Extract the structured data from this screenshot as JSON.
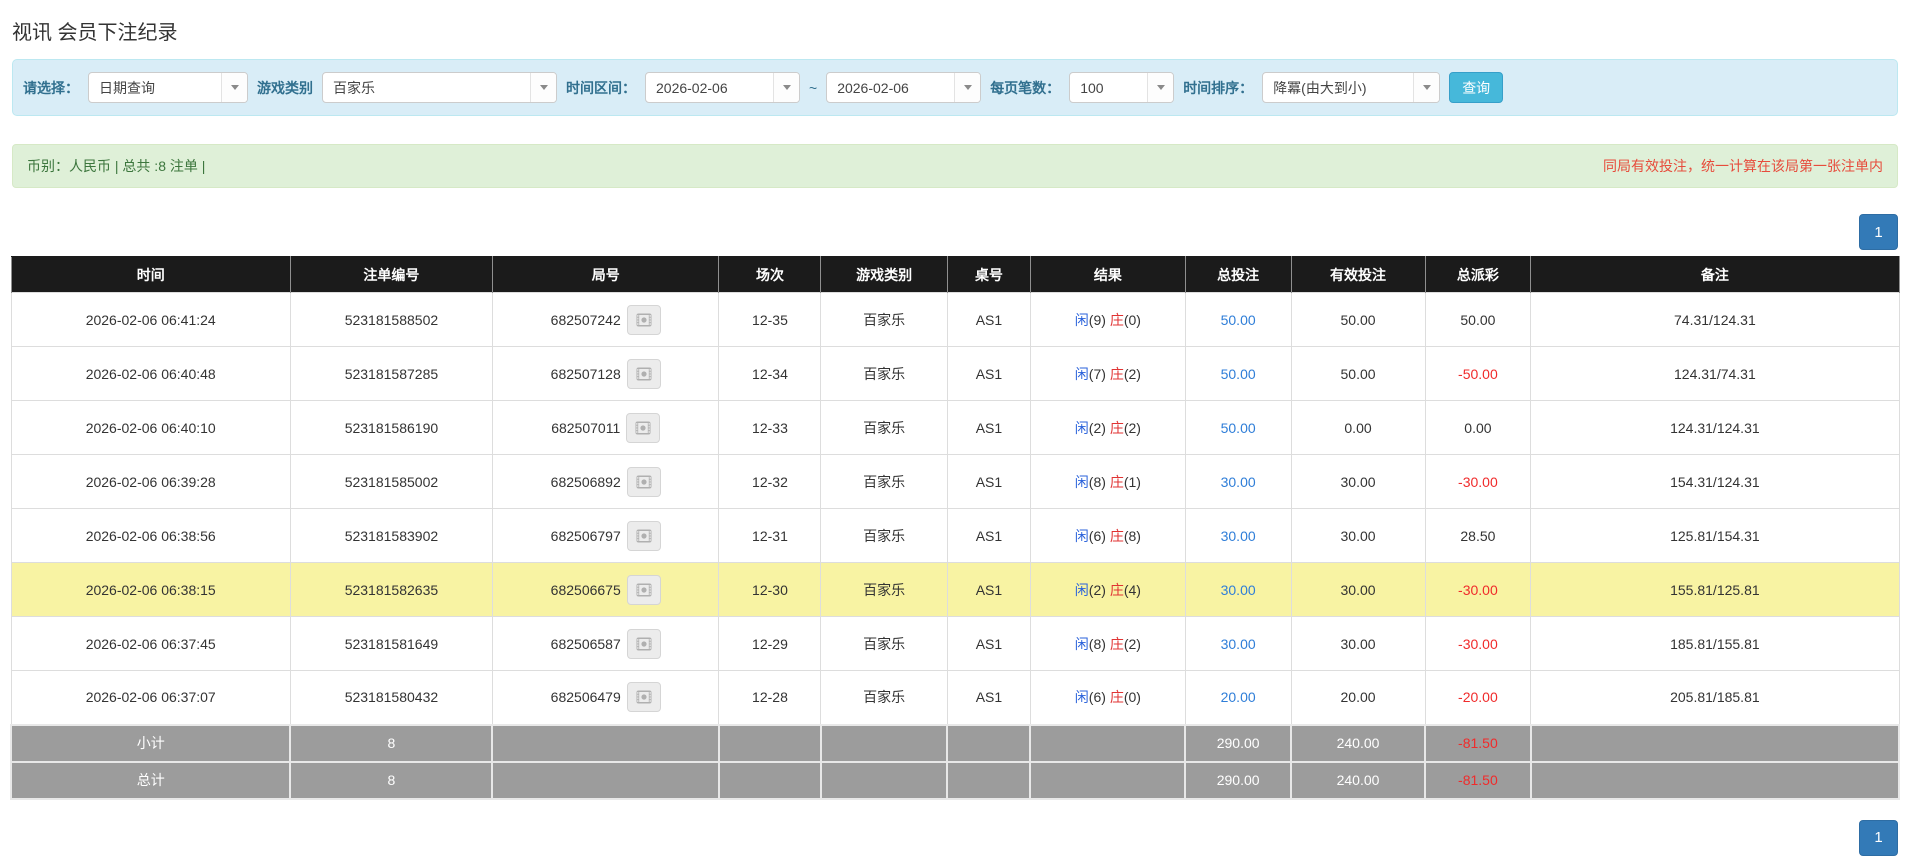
{
  "page": {
    "title": "视讯 会员下注纪录"
  },
  "filters": {
    "mode_label": "请选择：",
    "mode_value": "日期查询",
    "game_label": "游戏类别",
    "game_value": "百家乐",
    "range_label": "时间区间：",
    "range_start": "2026-02-06",
    "range_separator": "~",
    "range_end": "2026-02-06",
    "per_page_label": "每页笔数：",
    "per_page_value": "100",
    "sort_label": "时间排序：",
    "sort_value": "降冪(由大到小)",
    "search_button": "查询"
  },
  "summary": {
    "left": "币别：人民币 | 总共 :8 注单 |",
    "right": "同局有效投注，统一计算在该局第一张注单内"
  },
  "pagination": {
    "current_page": "1"
  },
  "icons": {
    "select_caret": "chevron-down-icon",
    "video_replay": "film-icon"
  },
  "colors": {
    "panel_bg": "#d9edf7",
    "summary_bg": "#dff0d8",
    "summary_text": "#3c763d",
    "warning_text": "#e74c3c",
    "header_bg": "#1b1b1b",
    "footer_bg": "#9c9c9c",
    "highlight_row": "#f8f3a3",
    "pagination_active": "#337ab7",
    "link_blue": "#2f7ed8",
    "player_blue": "#2a62db",
    "banker_red": "#e03333",
    "negative_red": "#f02b2b",
    "button_blue": "#46b8da"
  },
  "table": {
    "headers": [
      "时间",
      "注单编号",
      "局号",
      "场次",
      "游戏类别",
      "桌号",
      "结果",
      "总投注",
      "有效投注",
      "总派彩",
      "备注"
    ],
    "rows": [
      {
        "time": "2026-02-06 06:41:24",
        "bet_id": "523181588502",
        "round_id": "682507242",
        "session": "12-35",
        "game": "百家乐",
        "table_no": "AS1",
        "res_p_label": "闲",
        "res_p_num": "(9)",
        "res_b_label": "庄",
        "res_b_num": "(0)",
        "total_bet": "50.00",
        "valid_bet": "50.00",
        "payout": "50.00",
        "note": "74.31/124.31",
        "highlight": false
      },
      {
        "time": "2026-02-06 06:40:48",
        "bet_id": "523181587285",
        "round_id": "682507128",
        "session": "12-34",
        "game": "百家乐",
        "table_no": "AS1",
        "res_p_label": "闲",
        "res_p_num": "(7)",
        "res_b_label": "庄",
        "res_b_num": "(2)",
        "total_bet": "50.00",
        "valid_bet": "50.00",
        "payout": "-50.00",
        "note": "124.31/74.31",
        "highlight": false
      },
      {
        "time": "2026-02-06 06:40:10",
        "bet_id": "523181586190",
        "round_id": "682507011",
        "session": "12-33",
        "game": "百家乐",
        "table_no": "AS1",
        "res_p_label": "闲",
        "res_p_num": "(2)",
        "res_b_label": "庄",
        "res_b_num": "(2)",
        "total_bet": "50.00",
        "valid_bet": "0.00",
        "payout": "0.00",
        "note": "124.31/124.31",
        "highlight": false
      },
      {
        "time": "2026-02-06 06:39:28",
        "bet_id": "523181585002",
        "round_id": "682506892",
        "session": "12-32",
        "game": "百家乐",
        "table_no": "AS1",
        "res_p_label": "闲",
        "res_p_num": "(8)",
        "res_b_label": "庄",
        "res_b_num": "(1)",
        "total_bet": "30.00",
        "valid_bet": "30.00",
        "payout": "-30.00",
        "note": "154.31/124.31",
        "highlight": false
      },
      {
        "time": "2026-02-06 06:38:56",
        "bet_id": "523181583902",
        "round_id": "682506797",
        "session": "12-31",
        "game": "百家乐",
        "table_no": "AS1",
        "res_p_label": "闲",
        "res_p_num": "(6)",
        "res_b_label": "庄",
        "res_b_num": "(8)",
        "total_bet": "30.00",
        "valid_bet": "30.00",
        "payout": "28.50",
        "note": "125.81/154.31",
        "highlight": false
      },
      {
        "time": "2026-02-06 06:38:15",
        "bet_id": "523181582635",
        "round_id": "682506675",
        "session": "12-30",
        "game": "百家乐",
        "table_no": "AS1",
        "res_p_label": "闲",
        "res_p_num": "(2)",
        "res_b_label": "庄",
        "res_b_num": "(4)",
        "total_bet": "30.00",
        "valid_bet": "30.00",
        "payout": "-30.00",
        "note": "155.81/125.81",
        "highlight": true
      },
      {
        "time": "2026-02-06 06:37:45",
        "bet_id": "523181581649",
        "round_id": "682506587",
        "session": "12-29",
        "game": "百家乐",
        "table_no": "AS1",
        "res_p_label": "闲",
        "res_p_num": "(8)",
        "res_b_label": "庄",
        "res_b_num": "(2)",
        "total_bet": "30.00",
        "valid_bet": "30.00",
        "payout": "-30.00",
        "note": "185.81/155.81",
        "highlight": false
      },
      {
        "time": "2026-02-06 06:37:07",
        "bet_id": "523181580432",
        "round_id": "682506479",
        "session": "12-28",
        "game": "百家乐",
        "table_no": "AS1",
        "res_p_label": "闲",
        "res_p_num": "(6)",
        "res_b_label": "庄",
        "res_b_num": "(0)",
        "total_bet": "20.00",
        "valid_bet": "20.00",
        "payout": "-20.00",
        "note": "205.81/185.81",
        "highlight": false
      }
    ],
    "footer": [
      {
        "label": "小计",
        "count": "8",
        "total_bet": "290.00",
        "valid_bet": "240.00",
        "payout": "-81.50",
        "note": ""
      },
      {
        "label": "总计",
        "count": "8",
        "total_bet": "290.00",
        "valid_bet": "240.00",
        "payout": "-81.50",
        "note": ""
      }
    ]
  }
}
